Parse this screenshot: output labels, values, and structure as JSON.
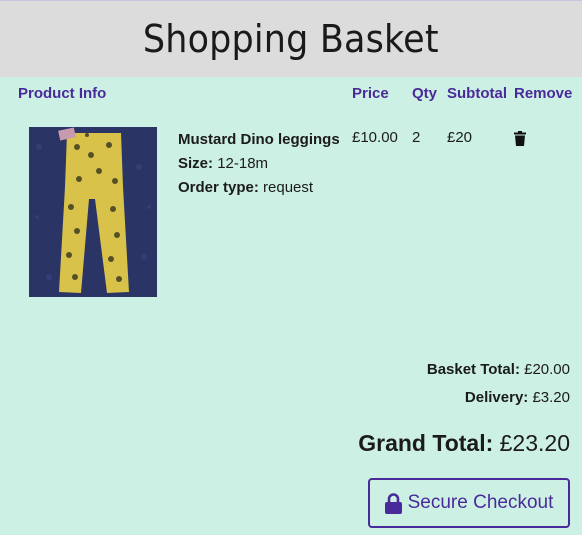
{
  "header": {
    "title": "Shopping Basket"
  },
  "columns": {
    "product_info": "Product Info",
    "price": "Price",
    "qty": "Qty",
    "subtotal": "Subtotal",
    "remove": "Remove"
  },
  "items": [
    {
      "name": "Mustard Dino leggings",
      "size_label": "Size:",
      "size": "12-18m",
      "order_type_label": "Order type:",
      "order_type": "request",
      "price": "£10.00",
      "qty": "2",
      "subtotal": "£20",
      "remove_icon": "trash-icon"
    }
  ],
  "totals": {
    "basket_total_label": "Basket Total:",
    "basket_total": "£20.00",
    "delivery_label": "Delivery:",
    "delivery": "£3.20",
    "grand_total_label": "Grand Total:",
    "grand_total": "£23.20"
  },
  "checkout": {
    "label": "Secure Checkout",
    "icon": "lock-icon"
  },
  "colors": {
    "accent": "#4a2a9a",
    "background": "#cdf0e4",
    "header_bg": "#dcdcdc"
  }
}
